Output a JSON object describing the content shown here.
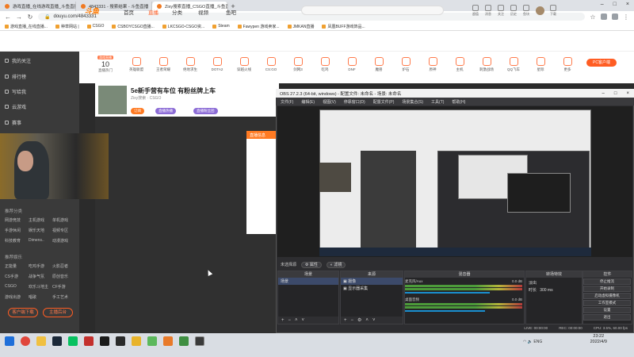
{
  "browser": {
    "tabs": [
      {
        "label": "游戏直播_在线游戏直播_斗鱼直播",
        "active": false
      },
      {
        "label": "4843331 - 搜索结果 - 斗鱼直播",
        "active": false
      },
      {
        "label": "Zixy搜索直播_CSGO直播_斗鱼直播",
        "active": true
      }
    ],
    "url": "douyu.com/4843331",
    "bookmarks": [
      "游戏直播_在线直播...",
      "种草网站 |",
      "CSGO",
      "CSBOYCSGO直播...",
      "LKCSGO-CSGO资...",
      "Steam",
      "Fawypen 游戏卖家...",
      "JMKAN直播",
      "凤凰BUFF游戏饰品..."
    ]
  },
  "site": {
    "logo": "斗鱼",
    "nav": [
      "首页",
      "直播",
      "分类",
      "视频",
      "鱼吧"
    ],
    "nav_active": "直播",
    "header_icons": [
      "超值",
      "消息",
      "关注",
      "历史",
      "鱼块",
      "下载"
    ]
  },
  "sidebar": {
    "items": [
      "我的关注",
      "排行榜",
      "写给我",
      "云游戏",
      "赛事"
    ],
    "section1": "推荐分类",
    "grid1": [
      "网游竞技",
      "主机游戏",
      "单机游戏",
      "手游休闲",
      "娱乐天地",
      "视频专区",
      "科技教育",
      "Dimens..",
      "动漫游戏"
    ],
    "section2": "推荐娱乐",
    "grid2": [
      "正能量",
      "吃鸡手游",
      "火影忍者",
      "CS手游",
      "战争气氛",
      "原创音乐",
      "CSGO",
      "欢乐斗地主",
      "CF手游",
      "游戏出游",
      "唱歌",
      "手工艺术"
    ],
    "btn_left": "客户端下载",
    "btn_right": "主播后台"
  },
  "category_row": {
    "first_badge": "游戏直播",
    "first_num": "10",
    "first_label": "直播热门",
    "items": [
      "英雄联盟",
      "王者荣耀",
      "绝地求生",
      "DOTA2",
      "穿越火线",
      "CS:GO",
      "剑网3",
      "吃鸡",
      "DNF",
      "魔兽",
      "炉石",
      "原神",
      "主机",
      "刺激战场",
      "QQ飞车",
      "星际",
      "更多"
    ],
    "pc_button": "PC客户端"
  },
  "room": {
    "title": "5e新手营有车位 有粉丝牌上车",
    "subtitle": "Zixy搜索  ·  CSGO",
    "tags": [
      "订阅",
      "直播热播",
      "直播粉丝团"
    ],
    "popup_title": "直播信息"
  },
  "obs": {
    "title": "OBS 27.2.3 (64-bit, windows) - 配置文件: 未命名 - 场景: 未命名",
    "menu": [
      "文件(F)",
      "编辑(E)",
      "视图(V)",
      "停靠窗口(D)",
      "配置文件(P)",
      "场景集合(S)",
      "工具(T)",
      "帮助(H)"
    ],
    "status_bar": "未选择源",
    "pill_props": "属性",
    "pill_filters": "滤镜",
    "docks": {
      "scenes": {
        "title": "场景",
        "items": [
          "场景"
        ]
      },
      "sources": {
        "title": "来源",
        "items": [
          "摄像",
          "显示器采集"
        ]
      },
      "mixer": {
        "title": "混音器",
        "channels": [
          {
            "name": "麦克风/Aux",
            "db": "0.0 dB",
            "level": 0.72
          },
          {
            "name": "桌面音频",
            "db": "0.0 dB",
            "level": 0.68
          }
        ]
      },
      "transitions": {
        "title": "转场特效",
        "type": "淡出",
        "duration_label": "时长",
        "duration": "300 ms"
      },
      "controls": {
        "title": "控件",
        "buttons": [
          "停止推流",
          "开始录制",
          "启动虚拟摄像机",
          "工作室模式",
          "设置",
          "退出"
        ]
      }
    },
    "stats": [
      "LIVE: 00:00:00",
      "REC: 00:00:00",
      "CPU: 3.5%, 60.00 fps"
    ]
  },
  "taskbar": {
    "time": "23:22",
    "date": "2022/4/9",
    "lang": "ENG"
  },
  "colors": {
    "accent": "#ff5d23",
    "obs_bg": "#2d2d30",
    "sidebar_bg": "#3a3a3a"
  }
}
